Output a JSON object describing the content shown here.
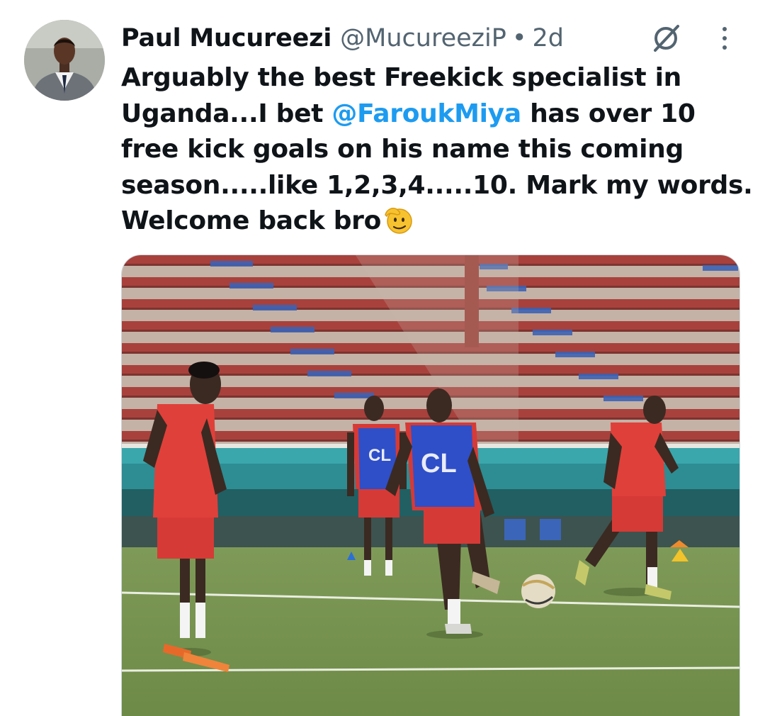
{
  "tweet": {
    "author_name": "Paul Mucureezi",
    "handle": "@MucureeziP",
    "separator": "•",
    "time": "2d",
    "text_lines": [
      "Arguably the best Freekick specialist in",
      "Uganda...I bet ",
      "@FaroukMiya",
      " has over 10",
      "free kick goals on his name this coming",
      "season.....like 1,2,3,4.....10. Mark my words.",
      "Welcome back bro"
    ],
    "emoji": "saluting-face",
    "media": {
      "description_icon": "photo",
      "bib_logo": "CL"
    }
  },
  "colors": {
    "text_primary": "#0f1419",
    "text_secondary": "#536471",
    "link": "#1d9bf0"
  },
  "icons": {
    "grok": "grok-icon",
    "more": "more-dots-icon"
  }
}
